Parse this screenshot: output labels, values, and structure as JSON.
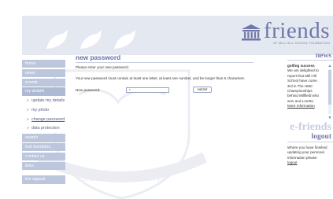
{
  "header": {
    "logo_word": "friends",
    "logo_sub": "OF MILL HILL SCHOOL FOUNDATION"
  },
  "sidebar": {
    "items": [
      {
        "label": "home"
      },
      {
        "label": "news"
      },
      {
        "label": "events"
      },
      {
        "label": "my details"
      }
    ],
    "sub_items": [
      {
        "label": "update my details"
      },
      {
        "label": "my photo"
      },
      {
        "label": "change password"
      },
      {
        "label": "data protection"
      }
    ],
    "items_after": [
      {
        "label": "search"
      },
      {
        "label": "lost members"
      },
      {
        "label": "contact us"
      },
      {
        "label": "links"
      }
    ],
    "appeal_label": "the appeal"
  },
  "main": {
    "title": "new password",
    "intro": "Please enter your new password.",
    "rule": "Your new password must contain at least one letter, at least one number, and be longer than 6 characters.",
    "password_label": "New password:",
    "password_value": "*",
    "submit_label": "submit"
  },
  "news": {
    "title": "news",
    "headline": "golfing success",
    "lines": [
      "We are delighted to",
      "report that Mill Hill",
      "School have come",
      "3rd in The HMC",
      "Championships",
      "behind Millfield who",
      "won and Loretto."
    ],
    "more_link": "More Information"
  },
  "efriends": {
    "title": "e-friends",
    "logout_title": "logout",
    "logout_lines": [
      "Where you have finished",
      "updating your personal",
      "information please"
    ],
    "logout_link": "logout"
  },
  "watermark": {
    "motto": "LICEN ET MUSAS"
  },
  "colors": {
    "accent": "#7078a8",
    "nav_bg": "#bcc6dc",
    "header_bg": "#e4e8f1"
  }
}
